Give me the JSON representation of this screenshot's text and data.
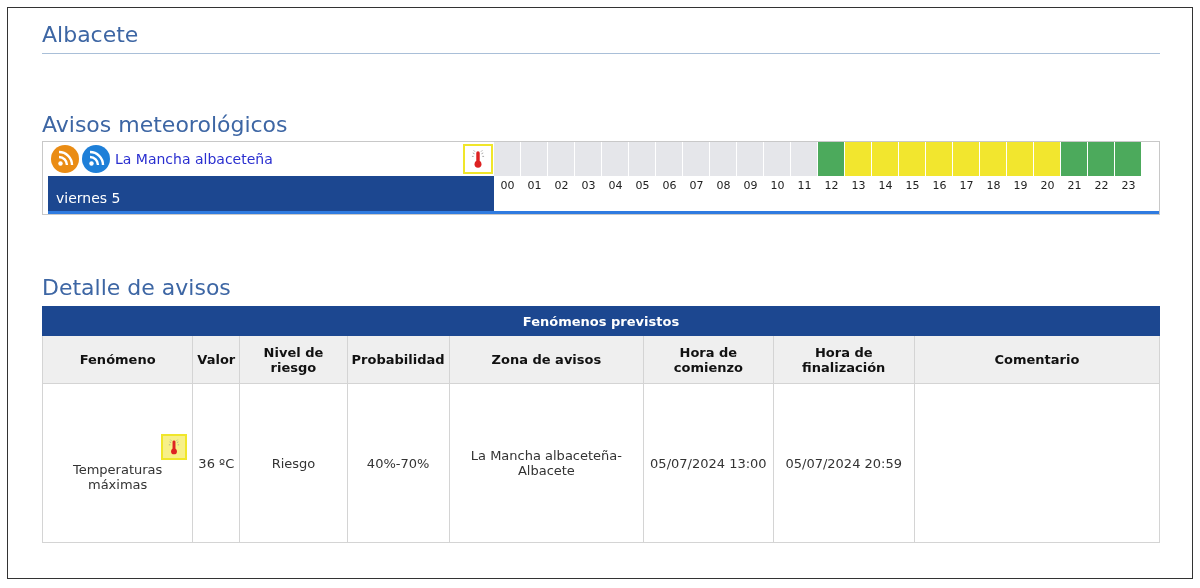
{
  "title": "Albacete",
  "warnings_section": {
    "heading": "Avisos meteorológicos",
    "zone": {
      "name": "La Mancha albaceteña",
      "day": "viernes 5",
      "hours": [
        {
          "label": "00",
          "color": "#e5e6ea"
        },
        {
          "label": "01",
          "color": "#e5e6ea"
        },
        {
          "label": "02",
          "color": "#e5e6ea"
        },
        {
          "label": "03",
          "color": "#e5e6ea"
        },
        {
          "label": "04",
          "color": "#e5e6ea"
        },
        {
          "label": "05",
          "color": "#e5e6ea"
        },
        {
          "label": "06",
          "color": "#e5e6ea"
        },
        {
          "label": "07",
          "color": "#e5e6ea"
        },
        {
          "label": "08",
          "color": "#e5e6ea"
        },
        {
          "label": "09",
          "color": "#e5e6ea"
        },
        {
          "label": "10",
          "color": "#e5e6ea"
        },
        {
          "label": "11",
          "color": "#e5e6ea"
        },
        {
          "label": "12",
          "color": "#4caa5c"
        },
        {
          "label": "13",
          "color": "#f2e62e"
        },
        {
          "label": "14",
          "color": "#f2e62e"
        },
        {
          "label": "15",
          "color": "#f2e62e"
        },
        {
          "label": "16",
          "color": "#f2e62e"
        },
        {
          "label": "17",
          "color": "#f2e62e"
        },
        {
          "label": "18",
          "color": "#f2e62e"
        },
        {
          "label": "19",
          "color": "#f2e62e"
        },
        {
          "label": "20",
          "color": "#f2e62e"
        },
        {
          "label": "21",
          "color": "#4caa5c"
        },
        {
          "label": "22",
          "color": "#4caa5c"
        },
        {
          "label": "23",
          "color": "#4caa5c"
        }
      ]
    }
  },
  "detail_section": {
    "heading": "Detalle de avisos",
    "table": {
      "caption": "Fenómenos previstos",
      "columns": [
        "Fenómeno",
        "Valor",
        "Nivel de riesgo",
        "Probabilidad",
        "Zona de avisos",
        "Hora de comienzo",
        "Hora de finalización",
        "Comentario"
      ],
      "rows": [
        {
          "phenomenon": "Temperaturas máximas",
          "value": "36 ºC",
          "risk": "Riesgo",
          "probability": "40%-70%",
          "zone": "La Mancha albaceteña-Albacete",
          "start": "05/07/2024 13:00",
          "end": "05/07/2024 20:59"
        }
      ]
    }
  }
}
